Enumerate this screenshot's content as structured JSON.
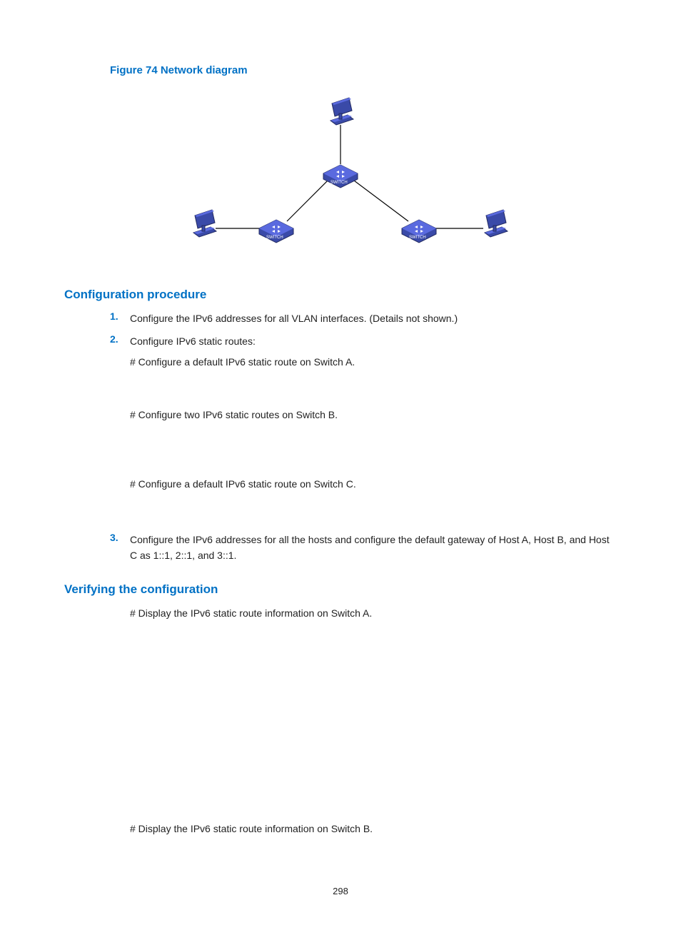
{
  "figure": {
    "caption": "Figure 74 Network diagram",
    "nodes": {
      "host_top": "Host",
      "host_left": "Host",
      "host_right": "Host",
      "switch_top": "SWITCH",
      "switch_left": "SWITCH",
      "switch_right": "SWITCH"
    }
  },
  "sections": {
    "config_procedure": {
      "title": "Configuration procedure",
      "steps": [
        {
          "num": "1.",
          "text": "Configure the IPv6 addresses for all VLAN interfaces. (Details not shown.)"
        },
        {
          "num": "2.",
          "text": "Configure IPv6 static routes:",
          "sub": [
            "# Configure a default IPv6 static route on Switch A.",
            "# Configure two IPv6 static routes on Switch B.",
            "# Configure a default IPv6 static route on Switch C."
          ]
        },
        {
          "num": "3.",
          "text": "Configure the IPv6 addresses for all the hosts and configure the default gateway of Host A, Host B, and Host C as 1::1, 2::1, and 3::1."
        }
      ]
    },
    "verify": {
      "title": "Verifying the configuration",
      "lines": [
        "# Display the IPv6 static route information on Switch A.",
        "# Display the IPv6 static route information on Switch B."
      ]
    }
  },
  "page_number": "298"
}
